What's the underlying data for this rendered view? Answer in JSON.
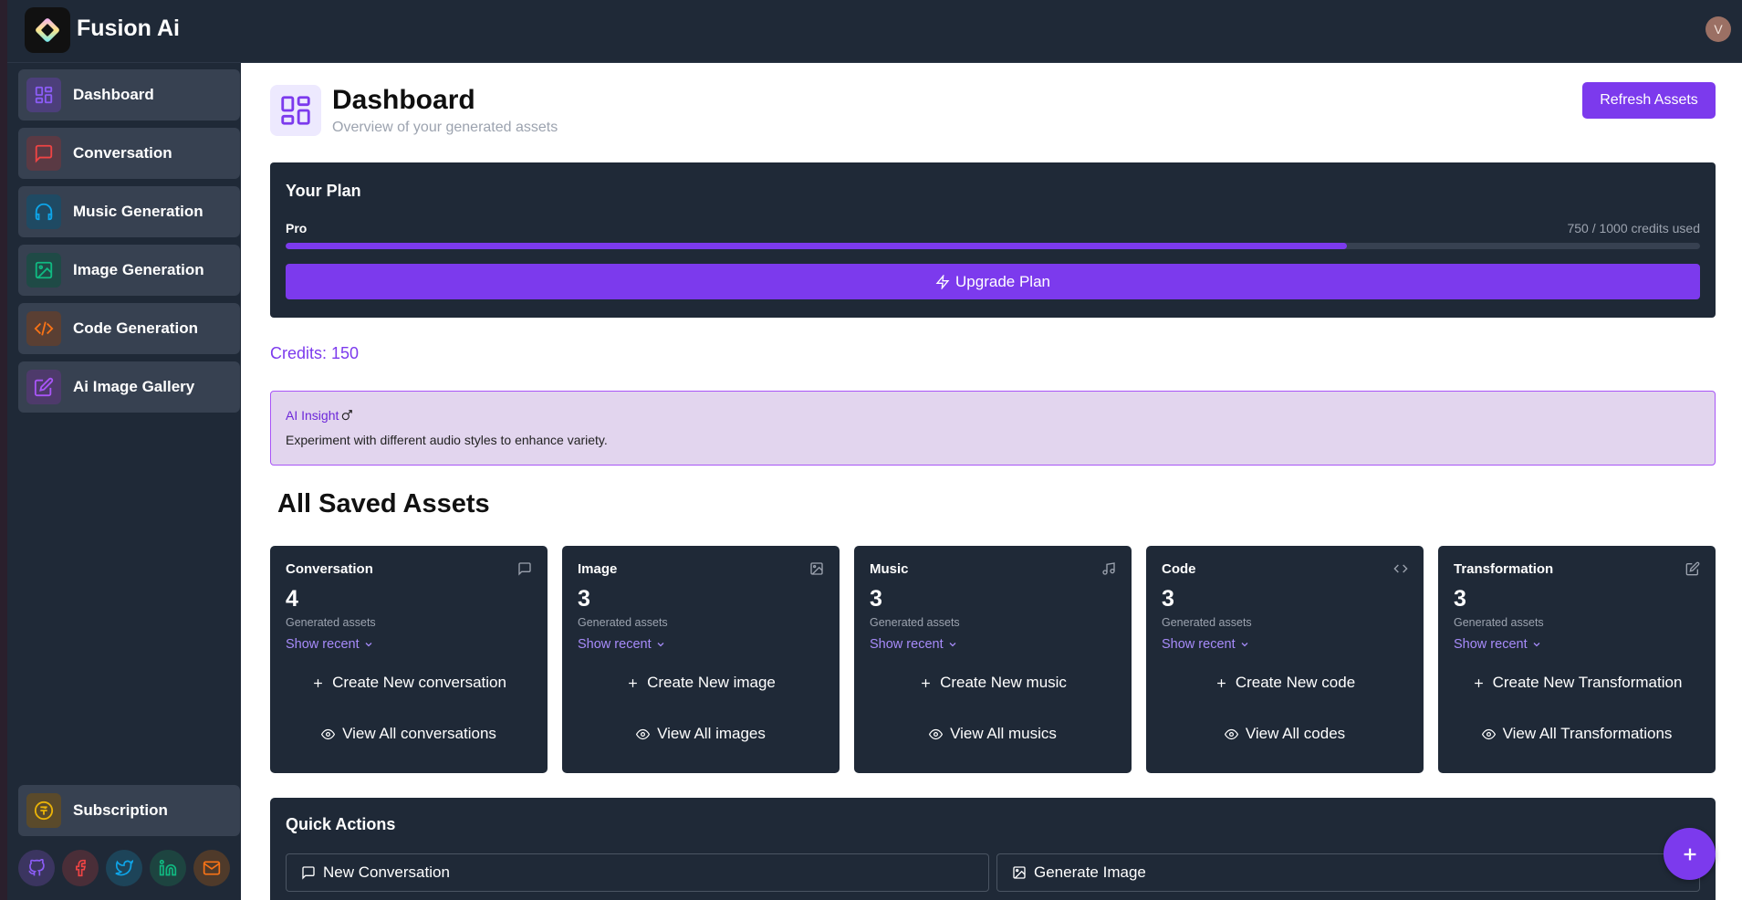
{
  "app": {
    "title": "Fusion Ai",
    "user_initial": "V"
  },
  "sidebar": {
    "items": [
      {
        "label": "Dashboard",
        "icon": "dashboard-icon",
        "color": "#8b5cf6"
      },
      {
        "label": "Conversation",
        "icon": "message-icon",
        "color": "#ef4444"
      },
      {
        "label": "Music Generation",
        "icon": "headphones-icon",
        "color": "#0ea5e9"
      },
      {
        "label": "Image Generation",
        "icon": "image-icon",
        "color": "#10b981"
      },
      {
        "label": "Code Generation",
        "icon": "code-icon",
        "color": "#f97316"
      },
      {
        "label": "Ai Image Gallery",
        "icon": "edit-icon",
        "color": "#a855f7"
      }
    ],
    "subscription_label": "Subscription",
    "socials": [
      "github-icon",
      "facebook-icon",
      "twitter-icon",
      "linkedin-icon",
      "mail-icon"
    ]
  },
  "header": {
    "title": "Dashboard",
    "subtitle": "Overview of your generated assets",
    "refresh_label": "Refresh Assets"
  },
  "plan": {
    "title": "Your Plan",
    "name": "Pro",
    "usage_text": "750 / 1000 credits used",
    "used": 750,
    "total": 1000,
    "upgrade_label": "Upgrade Plan"
  },
  "credits_text": "Credits: 150",
  "insight": {
    "title": "AI Insight",
    "text": "Experiment with different audio styles to enhance variety."
  },
  "assets": {
    "heading": "All Saved Assets",
    "cards": [
      {
        "title": "Conversation",
        "count": "4",
        "sub": "Generated assets",
        "recent": "Show recent",
        "create": "Create New conversation",
        "view": "View All conversations",
        "icon": "message-icon"
      },
      {
        "title": "Image",
        "count": "3",
        "sub": "Generated assets",
        "recent": "Show recent",
        "create": "Create New image",
        "view": "View All images",
        "icon": "image-icon"
      },
      {
        "title": "Music",
        "count": "3",
        "sub": "Generated assets",
        "recent": "Show recent",
        "create": "Create New music",
        "view": "View All musics",
        "icon": "music-icon"
      },
      {
        "title": "Code",
        "count": "3",
        "sub": "Generated assets",
        "recent": "Show recent",
        "create": "Create New code",
        "view": "View All codes",
        "icon": "code-icon"
      },
      {
        "title": "Transformation",
        "count": "3",
        "sub": "Generated assets",
        "recent": "Show recent",
        "create": "Create New Transformation",
        "view": "View All Transformations",
        "icon": "edit-icon"
      }
    ]
  },
  "quick_actions": {
    "title": "Quick Actions",
    "buttons": [
      "New Conversation",
      "Generate Image"
    ]
  },
  "colors": {
    "accent": "#7c3aed",
    "panel": "#1f2937"
  }
}
